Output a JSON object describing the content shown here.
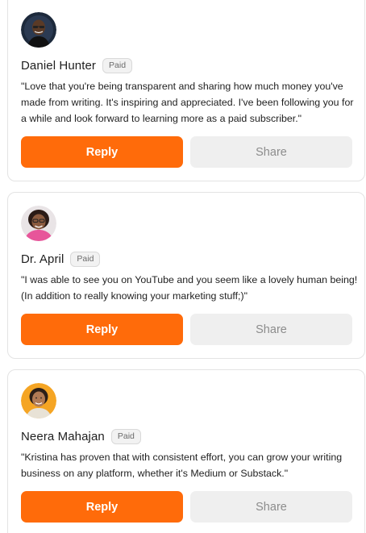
{
  "accent_color": "#ff6b0a",
  "testimonials": [
    {
      "name": "Daniel Hunter",
      "badge": "Paid",
      "avatar_icon": "avatar-photo",
      "quote": "\"Love that you're being transparent and sharing how much money you've made from writing. It's inspiring and appreciated. I've been following you for a while and look forward to learning more as a paid subscriber.\"",
      "reply_label": "Reply",
      "share_label": "Share"
    },
    {
      "name": "Dr. April",
      "badge": "Paid",
      "avatar_icon": "avatar-photo",
      "quote": "\"I was able to see you on YouTube and you seem like a lovely human being! (In addition to really knowing your marketing stuff;)\"",
      "reply_label": "Reply",
      "share_label": "Share"
    },
    {
      "name": "Neera Mahajan",
      "badge": "Paid",
      "avatar_icon": "avatar-photo",
      "quote": "\"Kristina has proven that with consistent effort, you can grow your writing business on any platform, whether it's Medium or Substack.\"",
      "reply_label": "Reply",
      "share_label": "Share"
    }
  ]
}
